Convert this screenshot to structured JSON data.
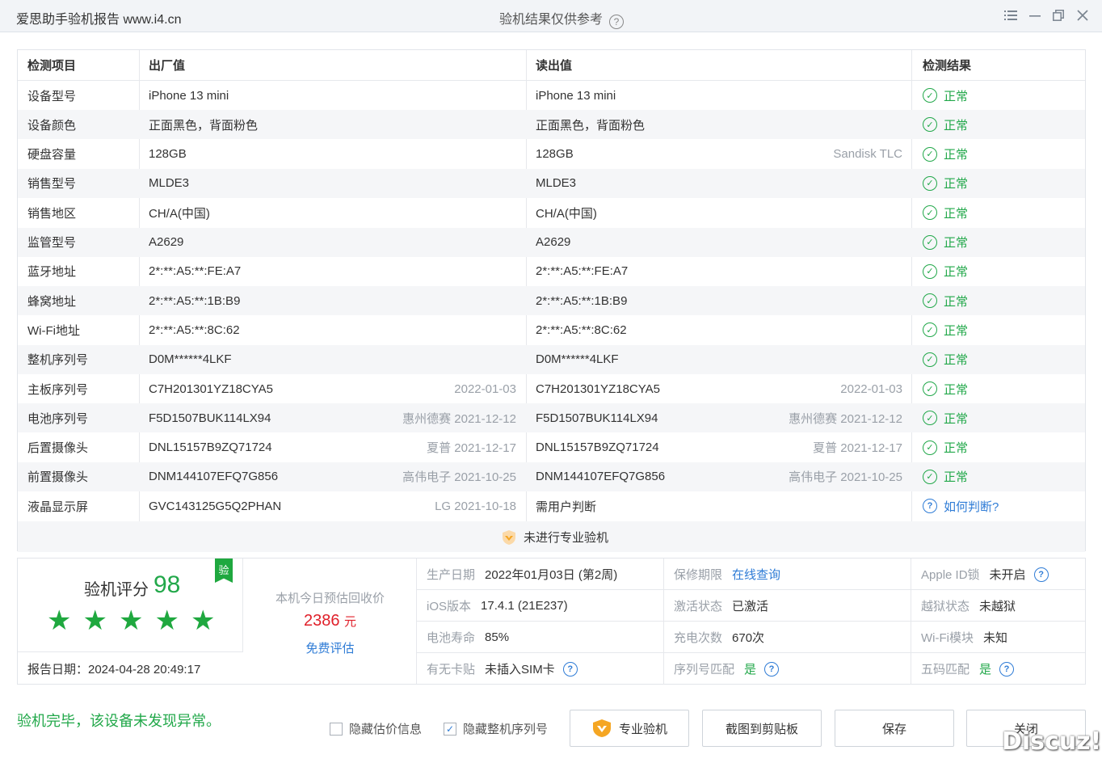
{
  "window": {
    "app_title": "爱思助手验机报告 www.i4.cn",
    "center_title": "验机结果仅供参考",
    "help_glyph": "?"
  },
  "table": {
    "headers": {
      "item": "检测项目",
      "factory": "出厂值",
      "read": "读出值",
      "result": "检测结果"
    },
    "rows": [
      {
        "item": "设备型号",
        "factory": "iPhone 13 mini",
        "factory_note": "",
        "read": "iPhone 13 mini",
        "read_note": "",
        "result": "正常"
      },
      {
        "item": "设备颜色",
        "factory": "正面黑色，背面粉色",
        "factory_note": "",
        "read": "正面黑色，背面粉色",
        "read_note": "",
        "result": "正常"
      },
      {
        "item": "硬盘容量",
        "factory": "128GB",
        "factory_note": "",
        "read": "128GB",
        "read_note": "Sandisk TLC",
        "result": "正常"
      },
      {
        "item": "销售型号",
        "factory": "MLDE3",
        "factory_note": "",
        "read": "MLDE3",
        "read_note": "",
        "result": "正常"
      },
      {
        "item": "销售地区",
        "factory": "CH/A(中国)",
        "factory_note": "",
        "read": "CH/A(中国)",
        "read_note": "",
        "result": "正常"
      },
      {
        "item": "监管型号",
        "factory": "A2629",
        "factory_note": "",
        "read": "A2629",
        "read_note": "",
        "result": "正常"
      },
      {
        "item": "蓝牙地址",
        "factory": "2*:**:A5:**:FE:A7",
        "factory_note": "",
        "read": "2*:**:A5:**:FE:A7",
        "read_note": "",
        "result": "正常"
      },
      {
        "item": "蜂窝地址",
        "factory": "2*:**:A5:**:1B:B9",
        "factory_note": "",
        "read": "2*:**:A5:**:1B:B9",
        "read_note": "",
        "result": "正常"
      },
      {
        "item": "Wi-Fi地址",
        "factory": "2*:**:A5:**:8C:62",
        "factory_note": "",
        "read": "2*:**:A5:**:8C:62",
        "read_note": "",
        "result": "正常"
      },
      {
        "item": "整机序列号",
        "factory": "D0M******4LKF",
        "factory_note": "",
        "read": "D0M******4LKF",
        "read_note": "",
        "result": "正常"
      },
      {
        "item": "主板序列号",
        "factory": "C7H201301YZ18CYA5",
        "factory_note": "2022-01-03",
        "read": "C7H201301YZ18CYA5",
        "read_note": "2022-01-03",
        "result": "正常"
      },
      {
        "item": "电池序列号",
        "factory": "F5D1507BUK114LX94",
        "factory_note": "惠州德赛 2021-12-12",
        "read": "F5D1507BUK114LX94",
        "read_note": "惠州德赛 2021-12-12",
        "result": "正常"
      },
      {
        "item": "后置摄像头",
        "factory": "DNL15157B9ZQ71724",
        "factory_note": "夏普 2021-12-17",
        "read": "DNL15157B9ZQ71724",
        "read_note": "夏普 2021-12-17",
        "result": "正常"
      },
      {
        "item": "前置摄像头",
        "factory": "DNM144107EFQ7G856",
        "factory_note": "高伟电子 2021-10-25",
        "read": "DNM144107EFQ7G856",
        "read_note": "高伟电子 2021-10-25",
        "result": "正常"
      },
      {
        "item": "液晶显示屏",
        "factory": "GVC143125G5Q2PHAN",
        "factory_note": "LG 2021-10-18",
        "read": "需用户判断",
        "read_note": "",
        "result": "如何判断?"
      }
    ],
    "footer_note": "未进行专业验机"
  },
  "score": {
    "label": "验机评分",
    "value": "98",
    "stars": 5,
    "badge": "验",
    "report_date": "报告日期：2024-04-28 20:49:17"
  },
  "price": {
    "label": "本机今日预估回收价",
    "value": "2386",
    "unit": "元",
    "link": "免费评估"
  },
  "info_grid": [
    [
      {
        "label": "生产日期",
        "value": "2022年01月03日 (第2周)"
      },
      {
        "label": "保修期限",
        "value": "在线查询"
      },
      {
        "label": "Apple ID锁",
        "value": "未开启"
      }
    ],
    [
      {
        "label": "iOS版本",
        "value": "17.4.1 (21E237)"
      },
      {
        "label": "激活状态",
        "value": "已激活"
      },
      {
        "label": "越狱状态",
        "value": "未越狱"
      }
    ],
    [
      {
        "label": "电池寿命",
        "value": "85%"
      },
      {
        "label": "充电次数",
        "value": "670次"
      },
      {
        "label": "Wi-Fi模块",
        "value": "未知"
      }
    ],
    [
      {
        "label": "有无卡贴",
        "value": "未插入SIM卡"
      },
      {
        "label": "序列号匹配",
        "value": "是"
      },
      {
        "label": "五码匹配",
        "value": "是"
      }
    ]
  ],
  "bottom": {
    "status": "验机完毕，该设备未发现异常。",
    "hide_price_label": "隐藏估价信息",
    "hide_serial_label": "隐藏整机序列号",
    "check_mark": "✓",
    "buttons": {
      "pro": "专业验机",
      "screenshot": "截图到剪贴板",
      "save": "保存",
      "close": "关闭"
    }
  },
  "watermark": "Discuz!",
  "colors": {
    "accent_green": "#22a84a",
    "link_blue": "#2f7cd6",
    "price_red": "#e0202a",
    "pro_orange": "#f5a623"
  },
  "icons": {
    "ok": "check-circle-icon",
    "help": "question-circle-icon",
    "star": "star-icon",
    "shield": "shield-icon",
    "menu": "menu-icon",
    "minimize": "minimize-icon",
    "restore": "restore-icon",
    "close": "close-icon"
  }
}
